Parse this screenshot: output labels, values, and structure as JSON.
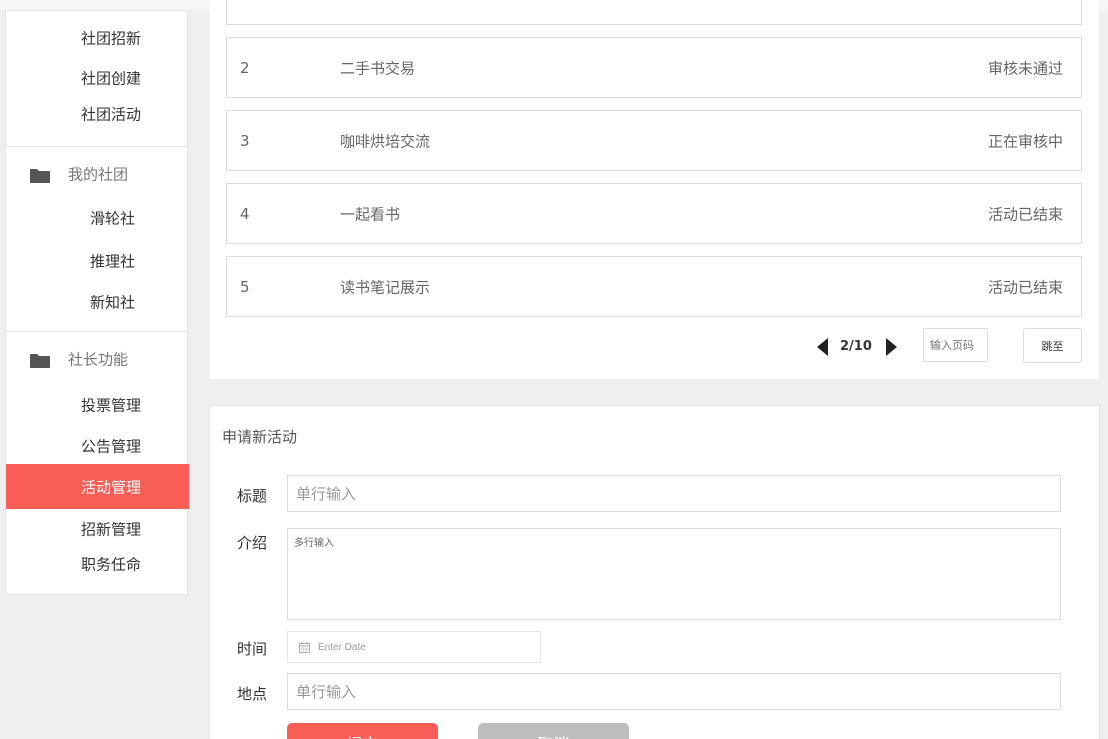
{
  "sidebar": {
    "top_items": [
      "社团招新",
      "社团创建",
      "社团活动"
    ],
    "group_my_club": "我的社团",
    "my_clubs": [
      "滑轮社",
      "推理社",
      "新知社"
    ],
    "group_leader": "社长功能",
    "leader_items": [
      "投票管理",
      "公告管理",
      "活动管理",
      "招新管理",
      "职务任命"
    ],
    "active_item": "活动管理"
  },
  "activity_list": {
    "rows": [
      {
        "num": "2",
        "title": "二手书交易",
        "status": "审核未通过"
      },
      {
        "num": "3",
        "title": "咖啡烘培交流",
        "status": "正在审核中"
      },
      {
        "num": "4",
        "title": "一起看书",
        "status": "活动已结束"
      },
      {
        "num": "5",
        "title": "读书笔记展示",
        "status": "活动已结束"
      }
    ],
    "pager": {
      "indicator": "2/10",
      "page_input_placeholder": "输入页码",
      "jump_label": "跳至"
    }
  },
  "form": {
    "title": "申请新活动",
    "title_label": "标题",
    "title_placeholder": "单行输入",
    "intro_label": "介绍",
    "intro_placeholder": "多行输入",
    "time_label": "时间",
    "time_placeholder": "Enter Date",
    "location_label": "地点",
    "location_placeholder": "单行输入",
    "submit_label": "提交",
    "cancel_label": "取消"
  },
  "colors": {
    "accent": "#f65e56",
    "cancel": "#bdbdbd"
  }
}
